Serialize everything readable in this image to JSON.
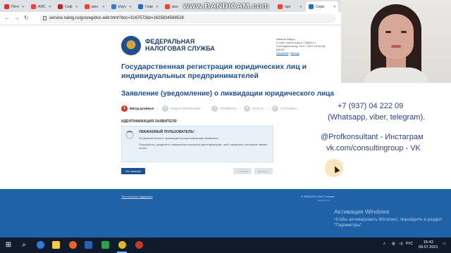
{
  "browser": {
    "tabs": [
      {
        "label": "Почт",
        "color": "#d9342b"
      },
      {
        "label": "АНС",
        "color": "#e8453c"
      },
      {
        "label": "Соф",
        "color": "#c02626"
      },
      {
        "label": "мон",
        "color": "#e8453c"
      },
      {
        "label": "Изуч",
        "color": "#3e7bc7"
      },
      {
        "label": "Глав",
        "color": "#2a6db5"
      },
      {
        "label": "мон",
        "color": "#e8453c"
      },
      {
        "label": "про",
        "color": "#e8453c"
      },
      {
        "label": "Серв",
        "color": "#2a6db5"
      }
    ],
    "url": "service.nalog.ru/gosreg/doc-edit.html?doc=3167573&t=1625834568528",
    "watermark": "www.BANDICAM.com"
  },
  "header": {
    "logo_line1": "ФЕДЕРАЛЬНАЯ",
    "logo_line2": "НАЛОГОВАЯ СЛУЖБА",
    "user_name": "Иванов Федор",
    "user_email": "E-mail: ivanov.ivanov.73@bk.ru",
    "user_last_login": "Последний вход: 09.07.2021 15:34:38 (МСК)",
    "profile_link": "Профиль",
    "logout_link": "Выход"
  },
  "main": {
    "page_title": "Государственная регистрация юридических лиц и индивидуальных предпринимателей",
    "section_title": "Заявление (уведомление) о ликвидации юридического лица",
    "steps": [
      {
        "num": "1",
        "label": "ВВОД ДАННЫХ",
        "active": true
      },
      {
        "num": "2",
        "label": "РЕДАКТИРОВАНИЕ",
        "active": false
      },
      {
        "num": "3",
        "label": "ПРОВЕРКА",
        "active": false
      },
      {
        "num": "4",
        "label": "ИТОГИ",
        "active": false
      },
      {
        "num": "5",
        "label": "ОТПРАВКА",
        "active": false
      }
    ],
    "identification_heading": "ИДЕНТИФИКАЦИЯ ЗАЯВИТЕЛЯ",
    "notice_title": "УВАЖАЕМЫЙ ПОЛЬЗОВАТЕЛЬ!",
    "notice_p1": "На данный момент производится идентификация заявителя.",
    "notice_p2": "Пожалуйста, дождитесь завершения процесса идентификации, либо проверьте состояние заявки позже.",
    "btn_home": "На главную",
    "btn_back": "< Назад",
    "btn_next": "Далее >"
  },
  "footer": {
    "support_link": "Техническая поддержка",
    "copyright": "© 2005-2021 ФНС России",
    "version": "Версия 1.0.7",
    "activation_title": "Активация Windows",
    "activation_sub": "Чтобы активировать Windows, перейдите в раздел \"Параметры\"."
  },
  "overlay": {
    "phone": "+7 (937) 04 222 09",
    "messengers": "(Whatsapp, viber, telegram).",
    "instagram": "@Profkonsultant - Инстаграм",
    "vk": "vk.com/consultingroup - VK"
  },
  "taskbar": {
    "lang": "РУС",
    "time": "15:43",
    "date": "09.07.2021"
  }
}
